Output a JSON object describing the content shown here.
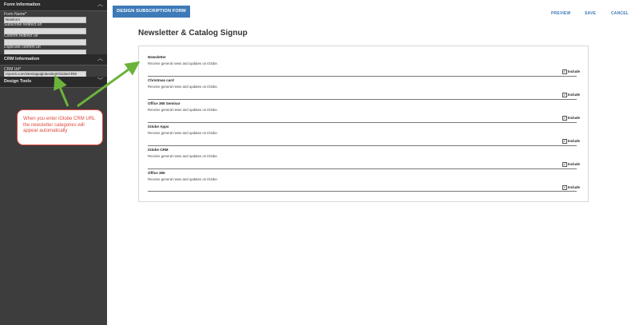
{
  "sidebar": {
    "form_information": {
      "title": "Form Information"
    },
    "form_name": {
      "label": "Form Name*",
      "value": "Newform"
    },
    "subscribe_redirect": {
      "label": "Subscribe redirect url",
      "value": ""
    },
    "confirm_redirect": {
      "label": "Confirm redirect url",
      "value": ""
    },
    "duplicate_confirm": {
      "label": "Duplicate confirm url",
      "value": ""
    },
    "crm_information": {
      "title": "CRM Information"
    },
    "crm_url": {
      "label": "CRM Url*",
      "value": "reponit.com/sites/appiglobesite2/iGlobeCRM"
    },
    "design_tools": {
      "title": "Design Tools"
    }
  },
  "toolbar": {
    "design_button": "DESIGN SUBSCRIPTION FORM",
    "preview": "PREVIEW",
    "save": "SAVE",
    "cancel": "CANCEL"
  },
  "form": {
    "title": "Newsletter & Catalog Signup",
    "include_label": "Include",
    "newsletters": [
      {
        "name": "Newsletter",
        "desc": "Receive general news and updates on iGlobe."
      },
      {
        "name": "Christmas card",
        "desc": "Receive general news and updates on iGlobe."
      },
      {
        "name": "Office 365 Seminar",
        "desc": "Receive general news and updates on iGlobe."
      },
      {
        "name": "iGlobe Apps",
        "desc": "Receive general news and updates on iGlobe."
      },
      {
        "name": "iGlobe CRM",
        "desc": "Receive general news and updates on iGlobe."
      },
      {
        "name": "Office 365",
        "desc": "Receive general news and updates on iGlobe."
      }
    ]
  },
  "callout": {
    "text": "When you enter iGlobe CRM URL the newsletter categories will appear automatically"
  },
  "colors": {
    "accent": "#3d7ab8",
    "sidebar": "#3d3d3d",
    "callout": "#e0473d",
    "arrow": "#6bb33a"
  },
  "icons": {
    "section_expanded": "chevron-up-icon",
    "section_collapsed": "chevron-down-icon",
    "checkbox": "checkbox-checked-icon"
  }
}
